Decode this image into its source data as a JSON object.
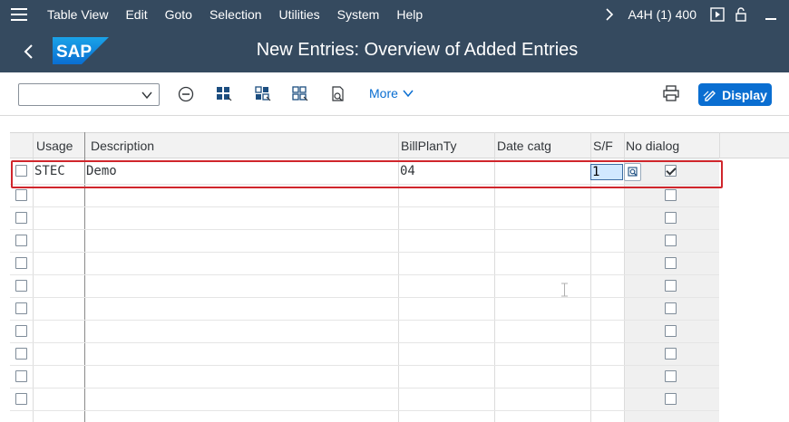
{
  "menubar": {
    "items": [
      "Table View",
      "Edit",
      "Goto",
      "Selection",
      "Utilities",
      "System",
      "Help"
    ],
    "system_info": "A4H (1) 400"
  },
  "titlebar": {
    "title": "New Entries: Overview of Added Entries",
    "logo_text": "SAP"
  },
  "toolbar": {
    "select_value": "",
    "more_label": "More",
    "display_label": "Display"
  },
  "table": {
    "columns": [
      "Usage",
      "Description",
      "BillPlanTy",
      "Date catg",
      "S/F",
      "No dialog"
    ],
    "rows": [
      {
        "usage": "STEC",
        "description": "Demo",
        "billplanty": "04",
        "date_catg": "",
        "sf": "1",
        "no_dialog": true
      }
    ],
    "empty_rows": 11
  },
  "colors": {
    "shell": "#354a5f",
    "accent": "#0a6ed1",
    "highlight": "#d0262c"
  }
}
